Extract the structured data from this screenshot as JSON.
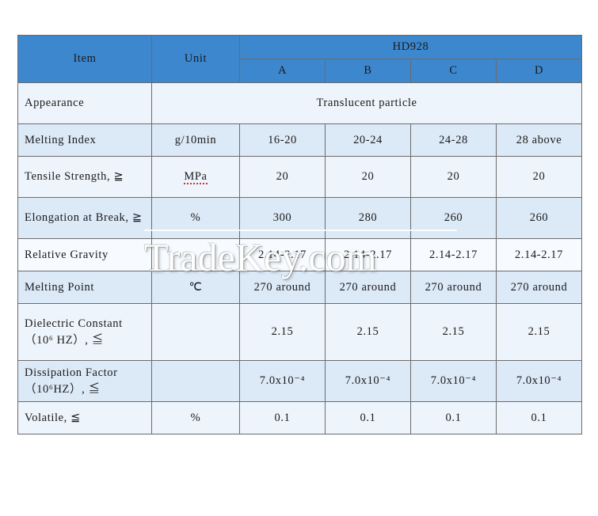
{
  "table": {
    "headers": {
      "item": "Item",
      "unit": "Unit",
      "product": "HD928",
      "grades": [
        "A",
        "B",
        "C",
        "D"
      ]
    },
    "rows": [
      {
        "label": "Appearance",
        "unit": "",
        "merged": true,
        "merged_value": "Translucent particle",
        "values": []
      },
      {
        "label": "Melting Index",
        "unit": "g/10min",
        "merged": false,
        "values": [
          "16-20",
          "20-24",
          "24-28",
          "28 above"
        ]
      },
      {
        "label": "Tensile  Strength, ≧",
        "unit": "MPa",
        "merged": false,
        "values": [
          "20",
          "20",
          "20",
          "20"
        ]
      },
      {
        "label": "Elongation       at Break,  ≧",
        "unit": "%",
        "merged": false,
        "values": [
          "300",
          "280",
          "260",
          "260"
        ]
      },
      {
        "label": "Relative Gravity",
        "unit": "",
        "merged": false,
        "values": [
          "2.14-2.17",
          "2.14-2.17",
          "2.14-2.17",
          "2.14-2.17"
        ]
      },
      {
        "label": "Melting Point",
        "unit": "℃",
        "merged": false,
        "values": [
          "270 around",
          "270 around",
          "270 around",
          "270 around"
        ]
      },
      {
        "label": "Dielectric Constant（10⁶  HZ）, ≦",
        "unit": "",
        "merged": false,
        "values": [
          "2.15",
          "2.15",
          "2.15",
          "2.15"
        ]
      },
      {
        "label": "Dissipation Factor（10⁶HZ）, ≦",
        "unit": "",
        "merged": false,
        "values": [
          "7.0x10⁻⁴",
          "7.0x10⁻⁴",
          "7.0x10⁻⁴",
          "7.0x10⁻⁴"
        ]
      },
      {
        "label": "Volatile, ≦",
        "unit": "%",
        "merged": false,
        "values": [
          "0.1",
          "0.1",
          "0.1",
          "0.1"
        ]
      }
    ]
  },
  "watermark": {
    "text": "TradeKey.com"
  },
  "colors": {
    "header_blue": "#3c87cd",
    "band_light": "#dce9f7",
    "band_pale": "#eef4fb",
    "border": "#6c6c6c"
  }
}
